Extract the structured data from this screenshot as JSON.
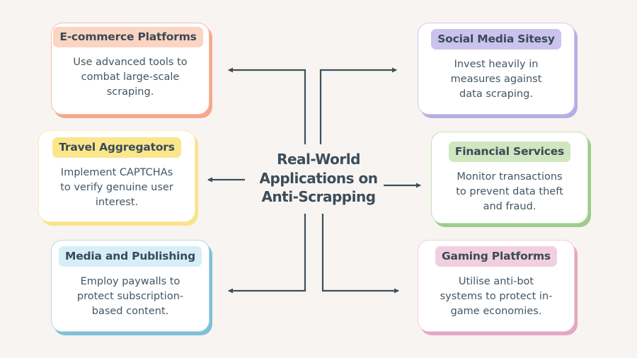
{
  "diagram": {
    "title_lines": [
      "Real-World",
      "Applications on",
      "Anti-Scrapping"
    ],
    "cards": [
      {
        "id": "ecommerce",
        "heading": "E-commerce Platforms",
        "description_lines": [
          "Use advanced tools to",
          "combat large-scale",
          "scraping."
        ],
        "accent": "#f6a88b",
        "pill": "#fbd4c2"
      },
      {
        "id": "social-media",
        "heading": "Social Media Sitesy",
        "description_lines": [
          "Invest heavily in",
          "measures against",
          "data scraping."
        ],
        "accent": "#b5aee6",
        "pill": "#cac3ed"
      },
      {
        "id": "travel",
        "heading": "Travel Aggregators",
        "description_lines": [
          "Implement CAPTCHAs",
          "to verify genuine user",
          "interest."
        ],
        "accent": "#f8e38a",
        "pill": "#fbe68c"
      },
      {
        "id": "financial",
        "heading": "Financial Services",
        "description_lines": [
          "Monitor transactions",
          "to prevent data theft",
          "and fraud."
        ],
        "accent": "#9fcc8e",
        "pill": "#cfe6bf"
      },
      {
        "id": "media",
        "heading": "Media and Publishing",
        "description_lines": [
          "Employ paywalls to",
          "protect subscription-",
          "based content."
        ],
        "accent": "#7ec0d8",
        "pill": "#d6eef8"
      },
      {
        "id": "gaming",
        "heading": "Gaming Platforms",
        "description_lines": [
          "Utilise anti-bot",
          "systems to protect in-",
          "game economies."
        ],
        "accent": "#e4a8c3",
        "pill": "#f2cfdf"
      }
    ],
    "connector_color": "#3d4f5c",
    "background": "#f8f4f1"
  }
}
